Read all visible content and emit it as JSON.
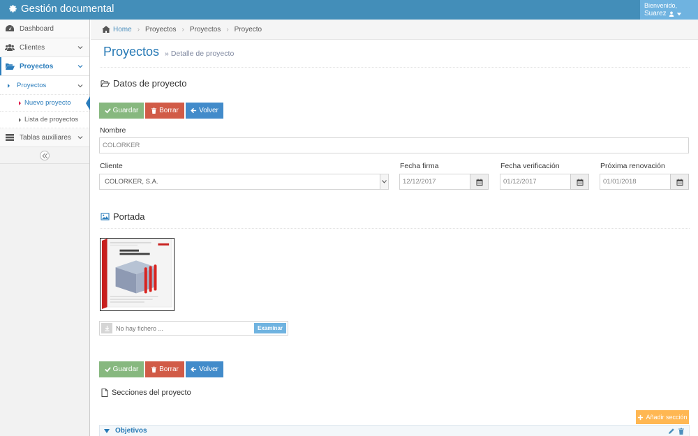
{
  "app": {
    "title": "Gestión documental"
  },
  "user": {
    "greeting": "Bienvenido,",
    "name": "Suarez"
  },
  "sidebar": {
    "items": [
      {
        "label": "Dashboard"
      },
      {
        "label": "Clientes"
      },
      {
        "label": "Proyectos"
      },
      {
        "label": "Tablas auxiliares"
      }
    ],
    "sub": {
      "group": "Proyectos",
      "items": [
        {
          "label": "Nuevo proyecto"
        },
        {
          "label": "Lista de proyectos"
        }
      ]
    }
  },
  "breadcrumb": {
    "items": [
      "Home",
      "Proyectos",
      "Proyectos",
      "Proyecto"
    ]
  },
  "page": {
    "title": "Proyectos",
    "subtitle": "Detalle de proyecto"
  },
  "datos": {
    "title": "Datos de proyecto"
  },
  "buttons": {
    "guardar": "Guardar",
    "borrar": "Borrar",
    "volver": "Volver",
    "add_section": "Añadir sección"
  },
  "form": {
    "nombre_label": "Nombre",
    "nombre_value": "COLORKER",
    "cliente_label": "Cliente",
    "cliente_value": "COLORKER, S.A.",
    "fecha_firma_label": "Fecha firma",
    "fecha_firma_value": "12/12/2017",
    "fecha_verif_label": "Fecha verificación",
    "fecha_verif_value": "01/12/2017",
    "renovacion_label": "Próxima renovación",
    "renovacion_value": "01/01/2018"
  },
  "portada": {
    "title": "Portada",
    "file_placeholder": "No hay fichero ...",
    "browse_label": "Examinar"
  },
  "secciones": {
    "title": "Secciones del proyecto",
    "first": "Objetivos"
  },
  "colors": {
    "primary": "#438eb9",
    "green": "#87b87f",
    "red": "#d15b47",
    "blue": "#428bca",
    "orange": "#ffb752"
  }
}
